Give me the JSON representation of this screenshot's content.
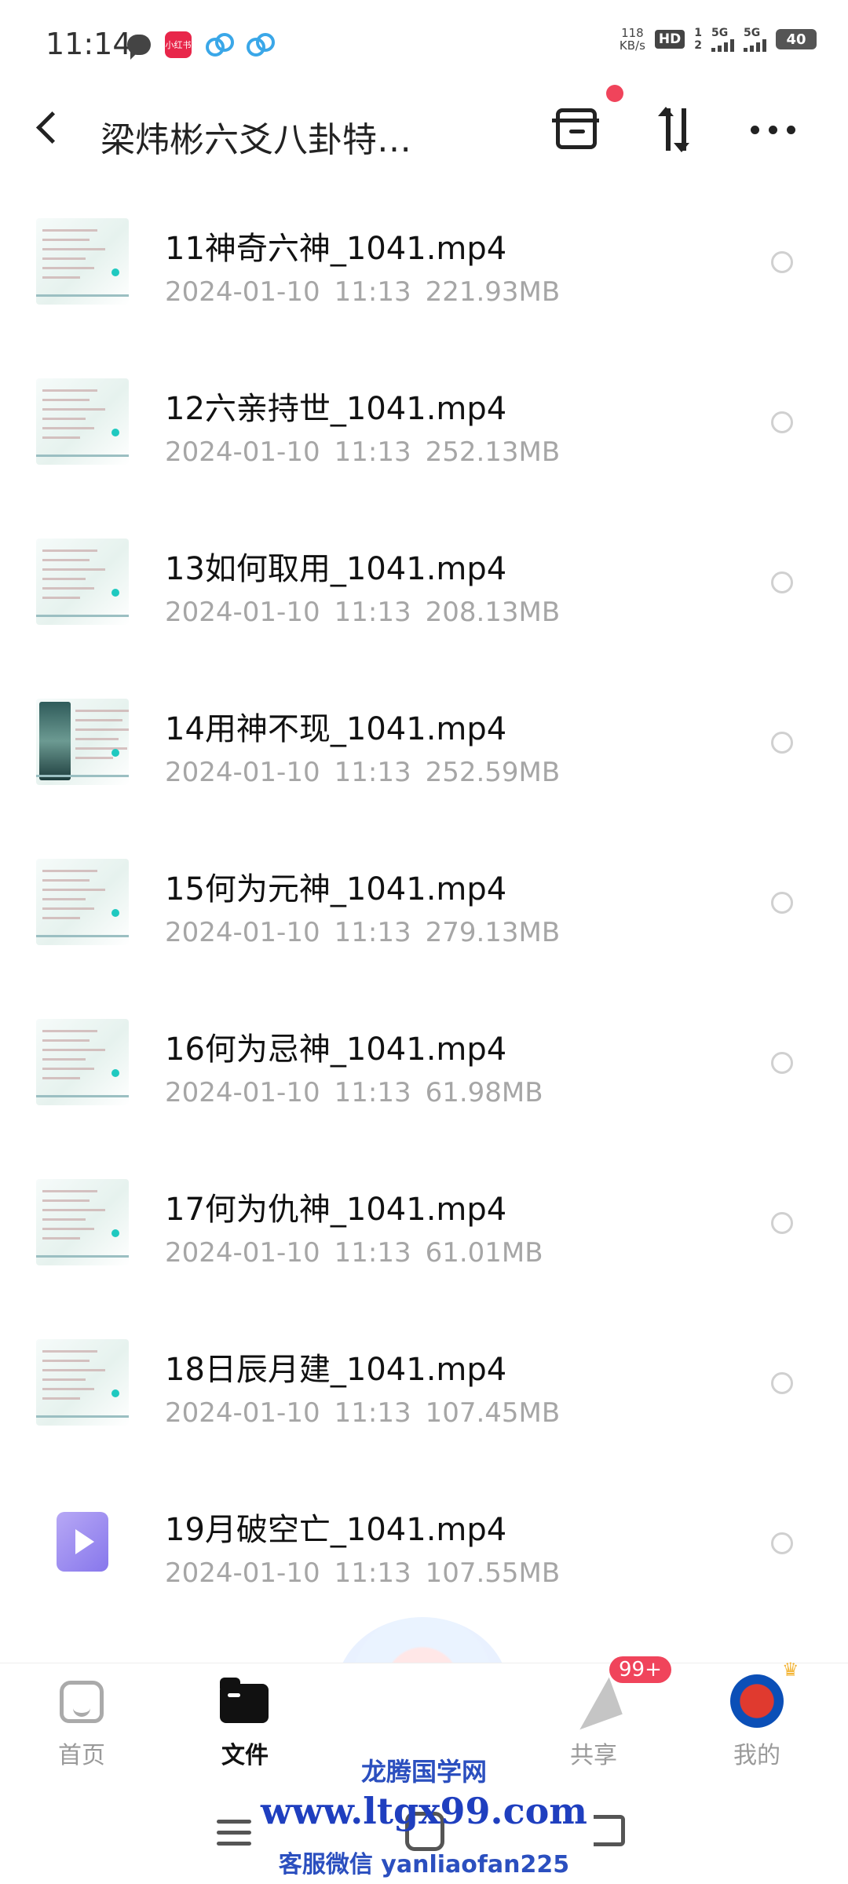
{
  "status_bar": {
    "time": "11:14",
    "app_badge_text": "小红书",
    "net_speed_value": "118",
    "net_speed_unit": "KB/s",
    "hd_label": "HD",
    "hd_sim": "1",
    "hd_sim2": "2",
    "sim1_net": "5G",
    "sim2_net": "5G",
    "battery": "40"
  },
  "header": {
    "title": "梁炜彬六爻八卦特…"
  },
  "files": [
    {
      "name": "11神奇六神_1041.mp4",
      "date": "2024-01-10",
      "time": "11:13",
      "size": "221.93MB",
      "thumb": "doc"
    },
    {
      "name": "12六亲持世_1041.mp4",
      "date": "2024-01-10",
      "time": "11:13",
      "size": "252.13MB",
      "thumb": "doc"
    },
    {
      "name": "13如何取用_1041.mp4",
      "date": "2024-01-10",
      "time": "11:13",
      "size": "208.13MB",
      "thumb": "doc"
    },
    {
      "name": "14用神不现_1041.mp4",
      "date": "2024-01-10",
      "time": "11:13",
      "size": "252.59MB",
      "thumb": "dark"
    },
    {
      "name": "15何为元神_1041.mp4",
      "date": "2024-01-10",
      "time": "11:13",
      "size": "279.13MB",
      "thumb": "doc"
    },
    {
      "name": "16何为忌神_1041.mp4",
      "date": "2024-01-10",
      "time": "11:13",
      "size": "61.98MB",
      "thumb": "doc"
    },
    {
      "name": "17何为仇神_1041.mp4",
      "date": "2024-01-10",
      "time": "11:13",
      "size": "61.01MB",
      "thumb": "doc"
    },
    {
      "name": "18日辰月建_1041.mp4",
      "date": "2024-01-10",
      "time": "11:13",
      "size": "107.45MB",
      "thumb": "doc"
    },
    {
      "name": "19月破空亡_1041.mp4",
      "date": "2024-01-10",
      "time": "11:13",
      "size": "107.55MB",
      "thumb": "video"
    }
  ],
  "bottom_nav": {
    "tabs": [
      {
        "label": "首页",
        "icon": "home-icon"
      },
      {
        "label": "文件",
        "icon": "folder-icon",
        "active": true
      },
      {
        "label": "共享",
        "icon": "share-icon"
      },
      {
        "label": "我的",
        "icon": "profile-icon"
      }
    ],
    "share_badge": "99+"
  },
  "watermark": {
    "line1": "龙腾国学网",
    "line2": "www.ltgx99.com",
    "line3": "客服微信 yanliaofan225"
  },
  "colors": {
    "accent_red": "#f0445b",
    "meta_gray": "#a6a6a6",
    "watermark_blue": "#1f3fbf"
  }
}
